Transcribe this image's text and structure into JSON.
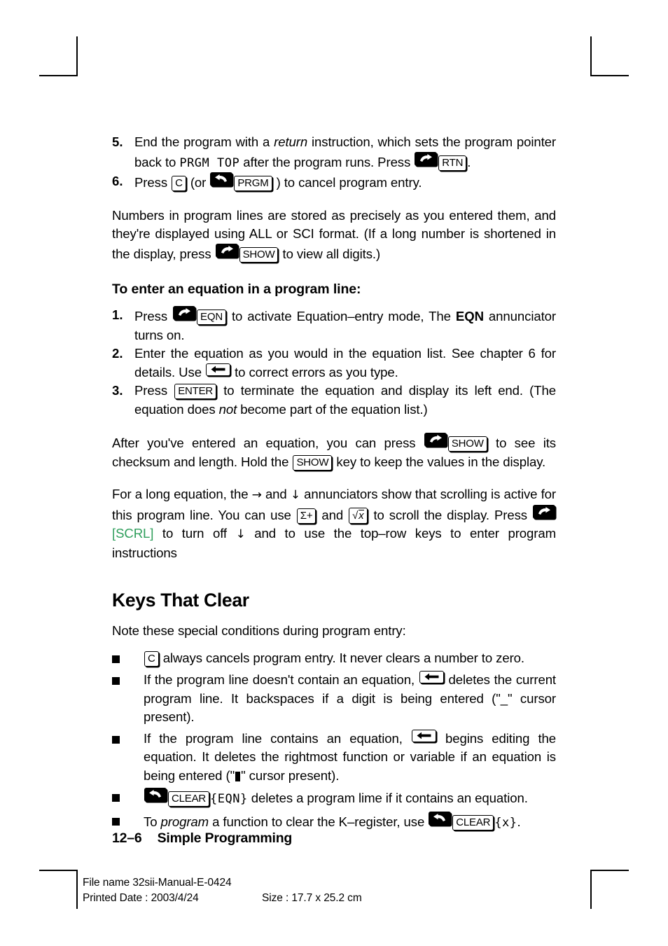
{
  "page": {
    "footer_page_number": "12–6",
    "footer_chapter": "Simple Programming",
    "print_file_name": "File name 32sii-Manual-E-0424",
    "print_date": "Printed Date : 2003/4/24",
    "print_size": "Size : 17.7 x 25.2 cm"
  },
  "colors": {
    "ink": "#000000",
    "soft_key_green": "#2f9e5c"
  },
  "steps_top": [
    {
      "number": "5.",
      "parts": [
        {
          "t": "text",
          "v": "End the program with a "
        },
        {
          "t": "italic",
          "v": "return"
        },
        {
          "t": "text",
          "v": " instruction, which sets the program pointer back to "
        },
        {
          "t": "lcd",
          "v": "PRGM TOP"
        },
        {
          "t": "text",
          "v": " after the program runs. Press "
        },
        {
          "t": "key-shift-right",
          "v": "right-shift"
        },
        {
          "t": "key",
          "v": "RTN"
        },
        {
          "t": "text",
          "v": "."
        }
      ]
    },
    {
      "number": "6.",
      "parts": [
        {
          "t": "text",
          "v": "Press "
        },
        {
          "t": "key",
          "v": "C"
        },
        {
          "t": "text",
          "v": " (or "
        },
        {
          "t": "key-shift-left",
          "v": "left-shift"
        },
        {
          "t": "key",
          "v": "PRGM"
        },
        {
          "t": "text",
          "v": " ) to cancel program entry."
        }
      ]
    }
  ],
  "paragraph_numbers": {
    "parts": [
      {
        "t": "text",
        "v": "Numbers in program lines are stored as precisely as you entered them, and they're displayed using ALL or SCI format. (If a long number is shortened in the display, press "
      },
      {
        "t": "key-shift-right",
        "v": "right-shift"
      },
      {
        "t": "key",
        "v": "SHOW"
      },
      {
        "t": "text",
        "v": " to view all digits.)"
      }
    ]
  },
  "subheading_equation": "To enter an equation in a program line:",
  "steps_equation": [
    {
      "number": "1.",
      "parts": [
        {
          "t": "text",
          "v": "Press "
        },
        {
          "t": "key-shift-right",
          "v": "right-shift"
        },
        {
          "t": "key",
          "v": "EQN"
        },
        {
          "t": "text",
          "v": " to activate Equation–entry mode, The "
        },
        {
          "t": "bold",
          "v": "EQN"
        },
        {
          "t": "text",
          "v": " annunciator turns on."
        }
      ]
    },
    {
      "number": "2.",
      "parts": [
        {
          "t": "text",
          "v": "Enter the equation as you would in the equation list. See chapter 6 for details. Use "
        },
        {
          "t": "key-backspace",
          "v": "backspace"
        },
        {
          "t": "text",
          "v": " to correct errors as you type."
        }
      ]
    },
    {
      "number": "3.",
      "parts": [
        {
          "t": "text",
          "v": "Press "
        },
        {
          "t": "key",
          "v": "ENTER"
        },
        {
          "t": "text",
          "v": " to terminate the equation and display its left end. (The equation does "
        },
        {
          "t": "italic",
          "v": "not"
        },
        {
          "t": "text",
          "v": " become part of the equation list.)"
        }
      ]
    }
  ],
  "paragraph_checksum": {
    "parts": [
      {
        "t": "text",
        "v": "After you've entered an equation, you can press "
      },
      {
        "t": "key-shift-right",
        "v": "right-shift"
      },
      {
        "t": "key",
        "v": "SHOW"
      },
      {
        "t": "text",
        "v": " to see its checksum and length. Hold the "
      },
      {
        "t": "key",
        "v": "SHOW"
      },
      {
        "t": "text",
        "v": " key to keep the values in the display."
      }
    ]
  },
  "paragraph_scroll": {
    "parts": [
      {
        "t": "text",
        "v": "For a long equation, the "
      },
      {
        "t": "ann",
        "v": "→"
      },
      {
        "t": "text",
        "v": " and "
      },
      {
        "t": "ann",
        "v": "↓"
      },
      {
        "t": "text",
        "v": " annunciators show that scrolling is active for this program line. You can use "
      },
      {
        "t": "key",
        "v": "Σ+"
      },
      {
        "t": "text",
        "v": " and "
      },
      {
        "t": "key-radical",
        "v": "√x"
      },
      {
        "t": "text",
        "v": " to scroll the display. Press "
      },
      {
        "t": "key-shift-right",
        "v": "right-shift"
      },
      {
        "t": "green",
        "v": "[SCRL]"
      },
      {
        "t": "text",
        "v": " to turn off "
      },
      {
        "t": "ann",
        "v": "↓"
      },
      {
        "t": "text",
        "v": " and to use the top–row keys to enter program instructions"
      }
    ]
  },
  "section_heading": "Keys That Clear",
  "paragraph_note": {
    "parts": [
      {
        "t": "text",
        "v": "Note these special conditions during program entry:"
      }
    ]
  },
  "bullets": [
    {
      "parts": [
        {
          "t": "key",
          "v": "C"
        },
        {
          "t": "text",
          "v": " always cancels program entry. It never clears a number to zero."
        }
      ]
    },
    {
      "parts": [
        {
          "t": "text",
          "v": "If the program line doesn't contain an equation, "
        },
        {
          "t": "key-backspace",
          "v": "backspace"
        },
        {
          "t": "text",
          "v": " deletes the current program line. It backspaces if a digit is being entered (\"_\" cursor present)."
        }
      ]
    },
    {
      "parts": [
        {
          "t": "text",
          "v": "If the program line contains an equation, "
        },
        {
          "t": "key-backspace",
          "v": "backspace"
        },
        {
          "t": "text",
          "v": " begins editing the equation. It deletes the rightmost function or variable if an equation is being entered (\""
        },
        {
          "t": "blockcursor",
          "v": "█"
        },
        {
          "t": "text",
          "v": "\" cursor present)."
        }
      ]
    },
    {
      "parts": [
        {
          "t": "key-shift-left",
          "v": "left-shift"
        },
        {
          "t": "key",
          "v": "CLEAR"
        },
        {
          "t": "lcd",
          "v": "{EQN}"
        },
        {
          "t": "text",
          "v": " deletes a program lime if it contains an equation."
        }
      ]
    },
    {
      "parts": [
        {
          "t": "text",
          "v": "To "
        },
        {
          "t": "italic",
          "v": "program"
        },
        {
          "t": "text",
          "v": " a function to clear the K–register, use "
        },
        {
          "t": "key-shift-left",
          "v": "left-shift"
        },
        {
          "t": "key",
          "v": "CLEAR"
        },
        {
          "t": "lcd",
          "v": "{x}"
        },
        {
          "t": "text",
          "v": "."
        }
      ]
    }
  ]
}
